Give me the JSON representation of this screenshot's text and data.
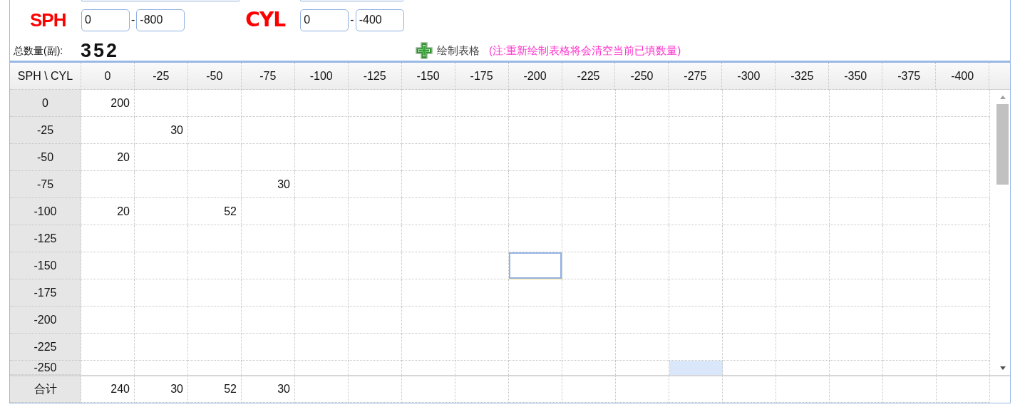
{
  "range_form": {
    "sph": {
      "label": "SPH",
      "from": "0",
      "to": "-800"
    },
    "cyl": {
      "label": "CYL",
      "from": "0",
      "to": "-400"
    },
    "separator": "-"
  },
  "total": {
    "label": "总数量(副):",
    "value": "352"
  },
  "draw_button": {
    "label": "绘制表格"
  },
  "note": "(注:重新绘制表格将会清空当前已填数量)",
  "table": {
    "corner": "SPH \\ CYL",
    "columns": [
      "0",
      "-25",
      "-50",
      "-75",
      "-100",
      "-125",
      "-150",
      "-175",
      "-200",
      "-225",
      "-250",
      "-275",
      "-300",
      "-325",
      "-350",
      "-375",
      "-400"
    ],
    "rows": [
      {
        "label": "0",
        "cells": [
          {
            "value": "200",
            "selected": false,
            "highlighted": false
          },
          {
            "selected": false,
            "highlighted": false
          },
          {
            "selected": false,
            "highlighted": false
          },
          {
            "selected": false,
            "highlighted": false
          },
          {
            "selected": false,
            "highlighted": false
          },
          {
            "selected": false,
            "highlighted": false
          },
          {
            "selected": false,
            "highlighted": false
          },
          {
            "selected": false,
            "highlighted": false
          },
          {
            "selected": false,
            "highlighted": false
          },
          {
            "selected": false,
            "highlighted": false
          },
          {
            "selected": false,
            "highlighted": false
          },
          {
            "selected": false,
            "highlighted": false
          },
          {
            "selected": false,
            "highlighted": false
          },
          {
            "selected": false,
            "highlighted": false
          },
          {
            "selected": false,
            "highlighted": false
          },
          {
            "selected": false,
            "highlighted": false
          },
          {
            "selected": false,
            "highlighted": false
          }
        ]
      },
      {
        "label": "-25",
        "cells": [
          {
            "selected": false,
            "highlighted": false
          },
          {
            "value": "30",
            "selected": false,
            "highlighted": false
          },
          {
            "selected": false,
            "highlighted": false
          },
          {
            "selected": false,
            "highlighted": false
          },
          {
            "selected": false,
            "highlighted": false
          },
          {
            "selected": false,
            "highlighted": false
          },
          {
            "selected": false,
            "highlighted": false
          },
          {
            "selected": false,
            "highlighted": false
          },
          {
            "selected": false,
            "highlighted": false
          },
          {
            "selected": false,
            "highlighted": false
          },
          {
            "selected": false,
            "highlighted": false
          },
          {
            "selected": false,
            "highlighted": false
          },
          {
            "selected": false,
            "highlighted": false
          },
          {
            "selected": false,
            "highlighted": false
          },
          {
            "selected": false,
            "highlighted": false
          },
          {
            "selected": false,
            "highlighted": false
          },
          {
            "selected": false,
            "highlighted": false
          }
        ]
      },
      {
        "label": "-50",
        "cells": [
          {
            "value": "20",
            "selected": false,
            "highlighted": false
          },
          {
            "selected": false,
            "highlighted": false
          },
          {
            "selected": false,
            "highlighted": false
          },
          {
            "selected": false,
            "highlighted": false
          },
          {
            "selected": false,
            "highlighted": false
          },
          {
            "selected": false,
            "highlighted": false
          },
          {
            "selected": false,
            "highlighted": false
          },
          {
            "selected": false,
            "highlighted": false
          },
          {
            "selected": false,
            "highlighted": false
          },
          {
            "selected": false,
            "highlighted": false
          },
          {
            "selected": false,
            "highlighted": false
          },
          {
            "selected": false,
            "highlighted": false
          },
          {
            "selected": false,
            "highlighted": false
          },
          {
            "selected": false,
            "highlighted": false
          },
          {
            "selected": false,
            "highlighted": false
          },
          {
            "selected": false,
            "highlighted": false
          },
          {
            "selected": false,
            "highlighted": false
          }
        ]
      },
      {
        "label": "-75",
        "cells": [
          {
            "selected": false,
            "highlighted": false
          },
          {
            "selected": false,
            "highlighted": false
          },
          {
            "selected": false,
            "highlighted": false
          },
          {
            "value": "30",
            "selected": false,
            "highlighted": false
          },
          {
            "selected": false,
            "highlighted": false
          },
          {
            "selected": false,
            "highlighted": false
          },
          {
            "selected": false,
            "highlighted": false
          },
          {
            "selected": false,
            "highlighted": false
          },
          {
            "selected": false,
            "highlighted": false
          },
          {
            "selected": false,
            "highlighted": false
          },
          {
            "selected": false,
            "highlighted": false
          },
          {
            "selected": false,
            "highlighted": false
          },
          {
            "selected": false,
            "highlighted": false
          },
          {
            "selected": false,
            "highlighted": false
          },
          {
            "selected": false,
            "highlighted": false
          },
          {
            "selected": false,
            "highlighted": false
          },
          {
            "selected": false,
            "highlighted": false
          }
        ]
      },
      {
        "label": "-100",
        "cells": [
          {
            "value": "20",
            "selected": false,
            "highlighted": false
          },
          {
            "selected": false,
            "highlighted": false
          },
          {
            "value": "52",
            "selected": false,
            "highlighted": false
          },
          {
            "selected": false,
            "highlighted": false
          },
          {
            "selected": false,
            "highlighted": false
          },
          {
            "selected": false,
            "highlighted": false
          },
          {
            "selected": false,
            "highlighted": false
          },
          {
            "selected": false,
            "highlighted": false
          },
          {
            "selected": false,
            "highlighted": false
          },
          {
            "selected": false,
            "highlighted": false
          },
          {
            "selected": false,
            "highlighted": false
          },
          {
            "selected": false,
            "highlighted": false
          },
          {
            "selected": false,
            "highlighted": false
          },
          {
            "selected": false,
            "highlighted": false
          },
          {
            "selected": false,
            "highlighted": false
          },
          {
            "selected": false,
            "highlighted": false
          },
          {
            "selected": false,
            "highlighted": false
          }
        ]
      },
      {
        "label": "-125",
        "cells": [
          {
            "selected": false,
            "highlighted": false
          },
          {
            "selected": false,
            "highlighted": false
          },
          {
            "selected": false,
            "highlighted": false
          },
          {
            "selected": false,
            "highlighted": false
          },
          {
            "selected": false,
            "highlighted": false
          },
          {
            "selected": false,
            "highlighted": false
          },
          {
            "selected": false,
            "highlighted": false
          },
          {
            "selected": false,
            "highlighted": false
          },
          {
            "selected": false,
            "highlighted": false
          },
          {
            "selected": false,
            "highlighted": false
          },
          {
            "selected": false,
            "highlighted": false
          },
          {
            "selected": false,
            "highlighted": false
          },
          {
            "selected": false,
            "highlighted": false
          },
          {
            "selected": false,
            "highlighted": false
          },
          {
            "selected": false,
            "highlighted": false
          },
          {
            "selected": false,
            "highlighted": false
          },
          {
            "selected": false,
            "highlighted": false
          }
        ]
      },
      {
        "label": "-150",
        "cells": [
          {
            "selected": false,
            "highlighted": false
          },
          {
            "selected": false,
            "highlighted": false
          },
          {
            "selected": false,
            "highlighted": false
          },
          {
            "selected": false,
            "highlighted": false
          },
          {
            "selected": false,
            "highlighted": false
          },
          {
            "selected": false,
            "highlighted": false
          },
          {
            "selected": false,
            "highlighted": false
          },
          {
            "selected": false,
            "highlighted": false
          },
          {
            "selected": true,
            "highlighted": false
          },
          {
            "selected": false,
            "highlighted": false
          },
          {
            "selected": false,
            "highlighted": false
          },
          {
            "selected": false,
            "highlighted": false
          },
          {
            "selected": false,
            "highlighted": false
          },
          {
            "selected": false,
            "highlighted": false
          },
          {
            "selected": false,
            "highlighted": false
          },
          {
            "selected": false,
            "highlighted": false
          },
          {
            "selected": false,
            "highlighted": false
          }
        ]
      },
      {
        "label": "-175",
        "cells": [
          {
            "selected": false,
            "highlighted": false
          },
          {
            "selected": false,
            "highlighted": false
          },
          {
            "selected": false,
            "highlighted": false
          },
          {
            "selected": false,
            "highlighted": false
          },
          {
            "selected": false,
            "highlighted": false
          },
          {
            "selected": false,
            "highlighted": false
          },
          {
            "selected": false,
            "highlighted": false
          },
          {
            "selected": false,
            "highlighted": false
          },
          {
            "selected": false,
            "highlighted": false
          },
          {
            "selected": false,
            "highlighted": false
          },
          {
            "selected": false,
            "highlighted": false
          },
          {
            "selected": false,
            "highlighted": false
          },
          {
            "selected": false,
            "highlighted": false
          },
          {
            "selected": false,
            "highlighted": false
          },
          {
            "selected": false,
            "highlighted": false
          },
          {
            "selected": false,
            "highlighted": false
          },
          {
            "selected": false,
            "highlighted": false
          }
        ]
      },
      {
        "label": "-200",
        "cells": [
          {
            "selected": false,
            "highlighted": false
          },
          {
            "selected": false,
            "highlighted": false
          },
          {
            "selected": false,
            "highlighted": false
          },
          {
            "selected": false,
            "highlighted": false
          },
          {
            "selected": false,
            "highlighted": false
          },
          {
            "selected": false,
            "highlighted": false
          },
          {
            "selected": false,
            "highlighted": false
          },
          {
            "selected": false,
            "highlighted": false
          },
          {
            "selected": false,
            "highlighted": false
          },
          {
            "selected": false,
            "highlighted": false
          },
          {
            "selected": false,
            "highlighted": false
          },
          {
            "selected": false,
            "highlighted": false
          },
          {
            "selected": false,
            "highlighted": false
          },
          {
            "selected": false,
            "highlighted": false
          },
          {
            "selected": false,
            "highlighted": false
          },
          {
            "selected": false,
            "highlighted": false
          },
          {
            "selected": false,
            "highlighted": false
          }
        ]
      },
      {
        "label": "-225",
        "cells": [
          {
            "selected": false,
            "highlighted": false
          },
          {
            "selected": false,
            "highlighted": false
          },
          {
            "selected": false,
            "highlighted": false
          },
          {
            "selected": false,
            "highlighted": false
          },
          {
            "selected": false,
            "highlighted": false
          },
          {
            "selected": false,
            "highlighted": false
          },
          {
            "selected": false,
            "highlighted": false
          },
          {
            "selected": false,
            "highlighted": false
          },
          {
            "selected": false,
            "highlighted": false
          },
          {
            "selected": false,
            "highlighted": false
          },
          {
            "selected": false,
            "highlighted": false
          },
          {
            "selected": false,
            "highlighted": false
          },
          {
            "selected": false,
            "highlighted": false
          },
          {
            "selected": false,
            "highlighted": false
          },
          {
            "selected": false,
            "highlighted": false
          },
          {
            "selected": false,
            "highlighted": false
          },
          {
            "selected": false,
            "highlighted": false
          }
        ]
      },
      {
        "label": "-250",
        "cells": [
          {
            "selected": false,
            "highlighted": false
          },
          {
            "selected": false,
            "highlighted": false
          },
          {
            "selected": false,
            "highlighted": false
          },
          {
            "selected": false,
            "highlighted": false
          },
          {
            "selected": false,
            "highlighted": false
          },
          {
            "selected": false,
            "highlighted": false
          },
          {
            "selected": false,
            "highlighted": false
          },
          {
            "selected": false,
            "highlighted": false
          },
          {
            "selected": false,
            "highlighted": false
          },
          {
            "selected": false,
            "highlighted": false
          },
          {
            "selected": false,
            "highlighted": false
          },
          {
            "selected": false,
            "highlighted": true
          },
          {
            "selected": false,
            "highlighted": false
          },
          {
            "selected": false,
            "highlighted": false
          },
          {
            "selected": false,
            "highlighted": false
          },
          {
            "selected": false,
            "highlighted": false
          },
          {
            "selected": false,
            "highlighted": false
          }
        ]
      }
    ],
    "totals": {
      "label": "合计",
      "cells": [
        {
          "value": "240"
        },
        {
          "value": "30"
        },
        {
          "value": "52"
        },
        {
          "value": "30"
        },
        {},
        {},
        {},
        {},
        {},
        {},
        {},
        {},
        {},
        {},
        {},
        {},
        {}
      ]
    }
  }
}
